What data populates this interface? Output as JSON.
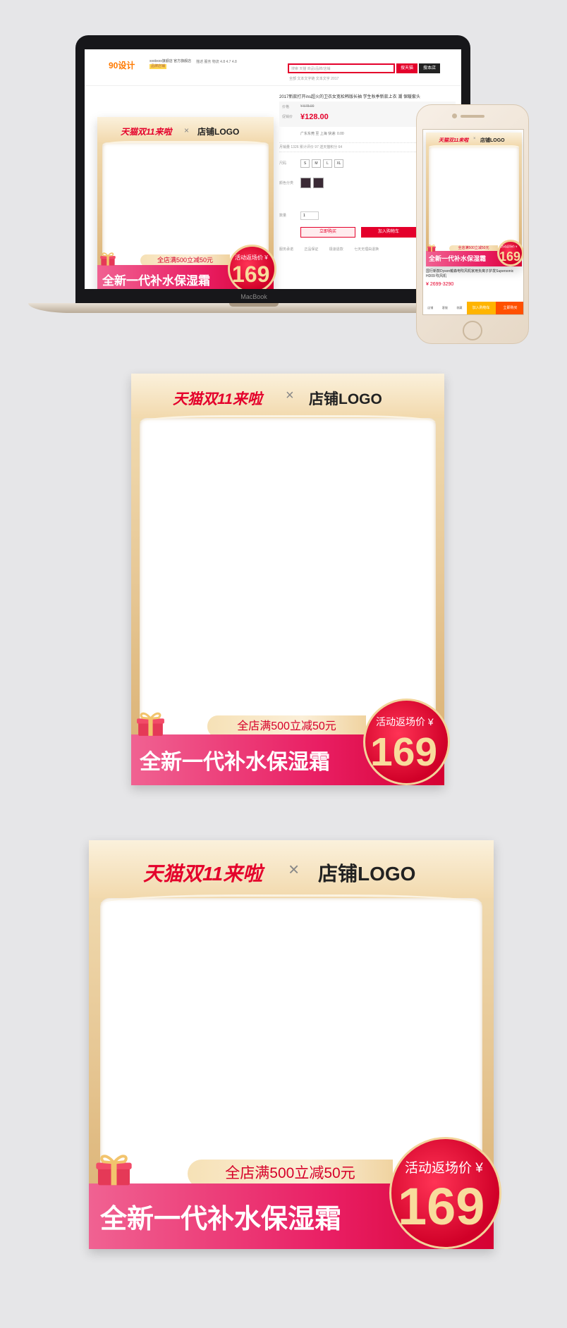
{
  "frame": {
    "tmall_text": "天猫双11来啦",
    "x_text": "×",
    "store_logo": "店铺LOGO",
    "coupon_text": "全店满500立减50元",
    "product_name": "全新一代补水保湿霜",
    "price_label": "活动返场价 ¥",
    "price_value": "169"
  },
  "laptop": {
    "brand_label": "MacBook",
    "site": {
      "logo": "90设计",
      "store_line": "xxxbxxx旗舰店 官方旗舰店",
      "store_badge": "品牌店铺",
      "rating": "描述 服务 物流 4.8 4.7 4.8",
      "search_placeholder": "搜索 天猫 商品/品牌/店铺",
      "search_button": "搜天猫",
      "search_store_button": "搜本店",
      "links": "全部  文本文字链  文本文字  2017"
    },
    "product": {
      "title": "2017新款打开ins超火的卫衣女宽松韩版长袖 学生秋季新款上衣 潮 保暖套头",
      "price_label_old": "价格",
      "price_label_now": "促销价",
      "price_old": "¥ 578.00",
      "price_now": "¥128.00",
      "shipping": "广东东莞 至 上海 快递: 0.00",
      "stats": "月销量 1326    累计评价 97    送天猫积分 64",
      "size_label": "尺码",
      "sizes": [
        "S",
        "M",
        "L",
        "XL"
      ],
      "color_label": "颜色分类",
      "qty_label": "数量",
      "qty_value": "1",
      "buy_now": "立即购买",
      "add_to_cart": "加入购物车",
      "info": "服务承诺 正品保证 极速退款 七天无理由退换"
    }
  },
  "phone": {
    "title": "国行新款Dyson戴森电吹风机家用负离子护发Supersonic HD09 吹风机",
    "price": "¥ 2699-3290",
    "tabs": [
      "店铺",
      "客服",
      "收藏"
    ],
    "add_to_cart": "加入购物车",
    "buy_now": "立即购买"
  }
}
